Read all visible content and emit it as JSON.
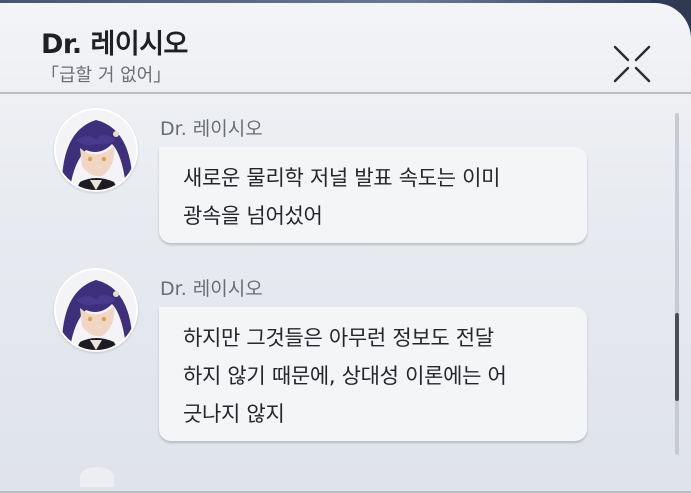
{
  "header": {
    "title": "Dr. 레이시오",
    "subtitle": "「급할 거 없어」"
  },
  "messages": [
    {
      "sender": "Dr. 레이시오",
      "lines": [
        "새로운 물리학 저널 발표 속도는 이미",
        "광속을 넘어섰어"
      ]
    },
    {
      "sender": "Dr. 레이시오",
      "lines": [
        "하지만 그것들은 아무런 정보도 전달",
        "하지 않기 때문에, 상대성 이론에는 어",
        "긋나지 않지"
      ]
    }
  ],
  "colors": {
    "panel_bg": "#e8ebf0",
    "bubble_bg": "#f4f5f7",
    "hair": "#3d2f7a",
    "eye": "#e0a24a"
  },
  "icons": {
    "close": "close-icon",
    "avatar": "avatar"
  }
}
